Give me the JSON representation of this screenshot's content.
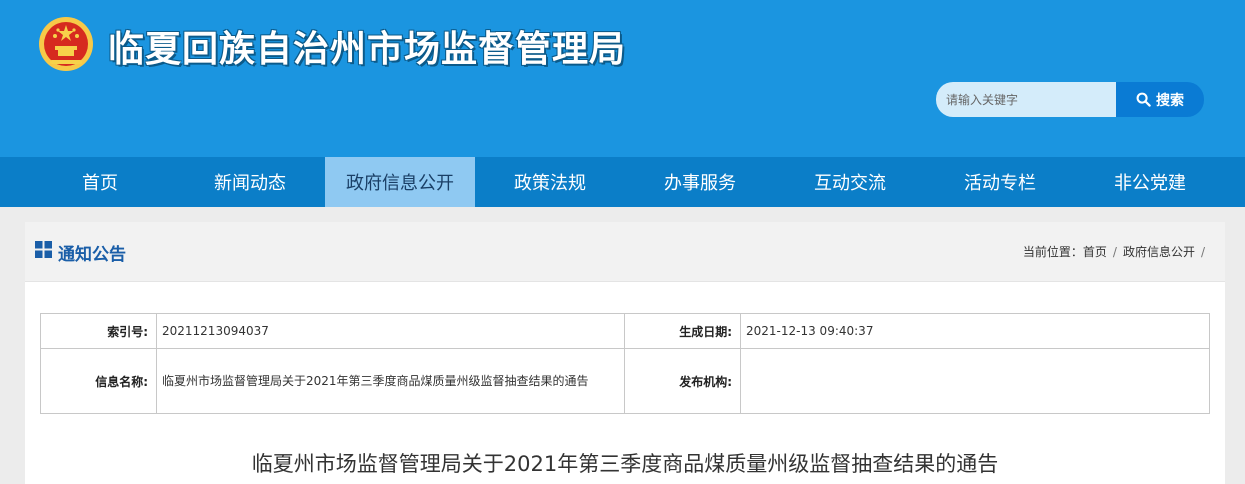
{
  "header": {
    "site_title": "临夏回族自治州市场监督管理局",
    "search_placeholder": "请输入关键字",
    "search_button": "搜索"
  },
  "nav": {
    "items": [
      "首页",
      "新闻动态",
      "政府信息公开",
      "政策法规",
      "办事服务",
      "互动交流",
      "活动专栏",
      "非公党建"
    ],
    "active_index": 2
  },
  "panel": {
    "title": "通知公告",
    "breadcrumb_prefix": "当前位置：",
    "breadcrumb": [
      "首页",
      "政府信息公开"
    ]
  },
  "info": {
    "index_label": "索引号:",
    "index_value": "20211213094037",
    "date_label": "生成日期:",
    "date_value": "2021-12-13 09:40:37",
    "name_label": "信息名称:",
    "name_value": "临夏州市场监督管理局关于2021年第三季度商品煤质量州级监督抽查结果的通告",
    "org_label": "发布机构:",
    "org_value": ""
  },
  "article": {
    "title": "临夏州市场监督管理局关于2021年第三季度商品煤质量州级监督抽查结果的通告"
  },
  "colors": {
    "header_bg": "#1b95e0",
    "nav_bg": "#0b7ec8",
    "nav_active_bg": "#8fc9f2",
    "accent": "#1a5ea8"
  },
  "icons": {
    "emblem": "national-emblem-icon",
    "search": "search-icon",
    "panel": "grid-icon"
  }
}
